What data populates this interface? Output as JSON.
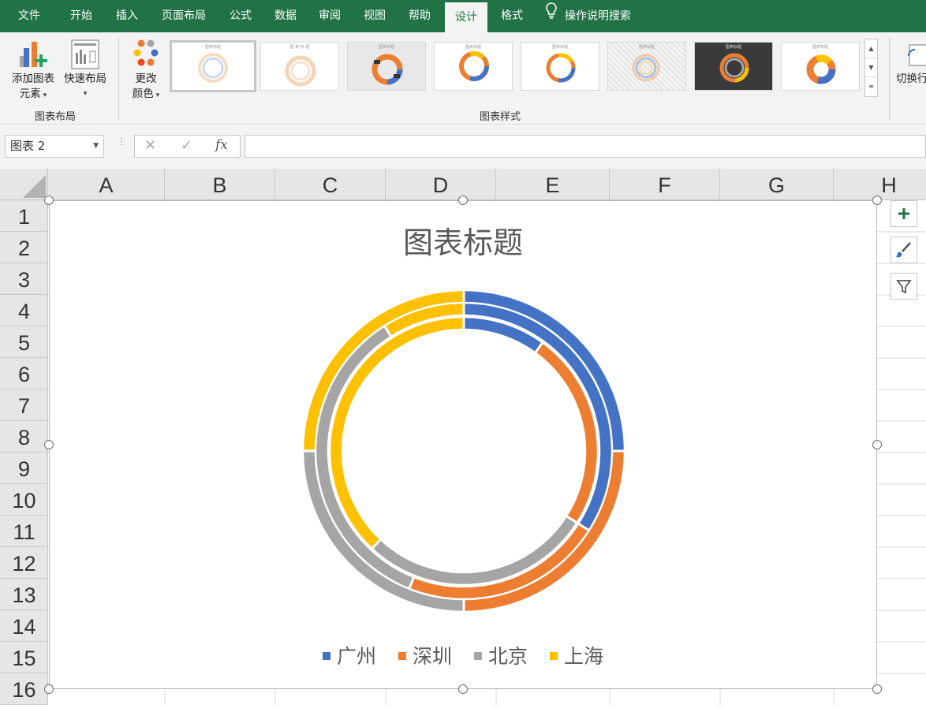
{
  "ribbon": {
    "tabs": [
      "文件",
      "开始",
      "插入",
      "页面布局",
      "公式",
      "数据",
      "审阅",
      "视图",
      "帮助",
      "设计",
      "格式"
    ],
    "active_tab": "设计",
    "tell_me": "操作说明搜索",
    "add_element_line1": "添加图表",
    "add_element_line2": "元素",
    "quick_layout": "快速布局",
    "change_colors_line1": "更改",
    "change_colors_line2": "颜色",
    "group_layout": "图表布局",
    "group_styles": "图表样式",
    "switch_row_col": "切换行",
    "thumb_titles": [
      "图表标题",
      "图 表 标 题",
      "图表标题",
      "图表标题",
      "图表标题",
      "图表标题",
      "图表标题",
      "图表标题"
    ]
  },
  "formula_bar": {
    "name_box": "图表 2",
    "cancel": "✕",
    "enter": "✓",
    "fx": "fx",
    "value": ""
  },
  "columns": [
    "A",
    "B",
    "C",
    "D",
    "E",
    "F",
    "G",
    "H"
  ],
  "rows": [
    "1",
    "2",
    "3",
    "4",
    "5",
    "6",
    "7",
    "8",
    "9",
    "10",
    "11",
    "12",
    "13",
    "14",
    "15",
    "16"
  ],
  "chart": {
    "title": "图表标题"
  },
  "chart_data": {
    "type": "doughnut",
    "title": "图表标题",
    "categories": [
      "广州",
      "深圳",
      "北京",
      "上海"
    ],
    "colors": [
      "#4472C4",
      "#ED7D31",
      "#A5A5A5",
      "#FFC000"
    ],
    "legend_position": "bottom",
    "series": [
      {
        "values": [
          25,
          25,
          25,
          25
        ]
      },
      {
        "values": [
          34,
          22,
          35,
          9
        ]
      },
      {
        "values": [
          10,
          24,
          28,
          38
        ]
      }
    ]
  }
}
